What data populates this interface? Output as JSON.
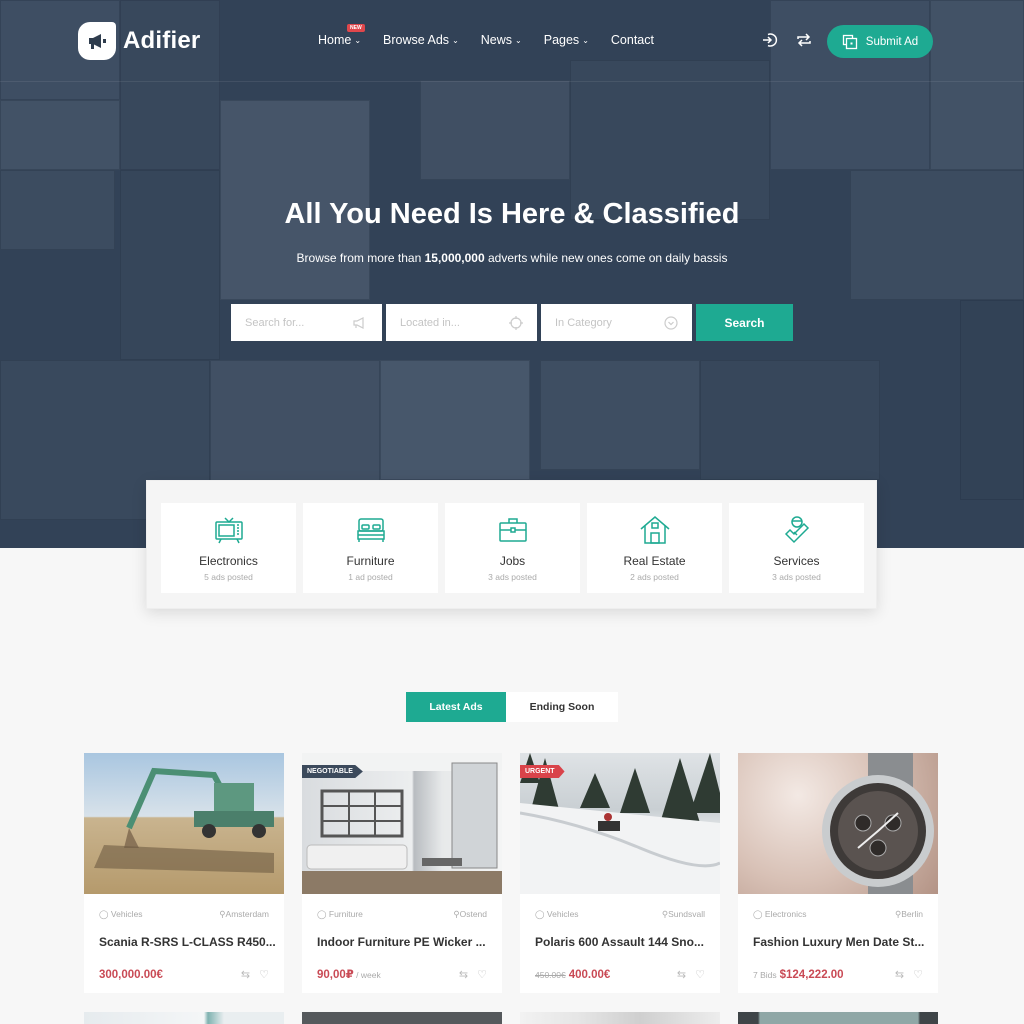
{
  "brand": {
    "name": "Adifier",
    "accent": "#1eaa92",
    "price_color": "#c94a55"
  },
  "nav": {
    "menu": [
      {
        "label": "Home",
        "has_dropdown": true,
        "badge": "NEW"
      },
      {
        "label": "Browse Ads",
        "has_dropdown": true
      },
      {
        "label": "News",
        "has_dropdown": true
      },
      {
        "label": "Pages",
        "has_dropdown": true
      },
      {
        "label": "Contact",
        "has_dropdown": false
      }
    ],
    "icons": [
      "login-icon",
      "compare-icon"
    ],
    "submit_label": "Submit Ad"
  },
  "hero": {
    "title": "All You Need Is Here & Classified",
    "subtitle_before": "Browse from more than ",
    "subtitle_bold": "15,000,000",
    "subtitle_after": " adverts while new ones come on daily bassis",
    "search": {
      "keyword_placeholder": "Search for...",
      "location_placeholder": "Located in...",
      "category_placeholder": "In Category",
      "button_label": "Search"
    }
  },
  "categories": [
    {
      "name": "Electronics",
      "count": "5 ads posted",
      "icon": "tv-icon"
    },
    {
      "name": "Furniture",
      "count": "1 ad posted",
      "icon": "bed-icon"
    },
    {
      "name": "Jobs",
      "count": "3 ads posted",
      "icon": "briefcase-icon"
    },
    {
      "name": "Real Estate",
      "count": "2 ads posted",
      "icon": "house-icon"
    },
    {
      "name": "Services",
      "count": "3 ads posted",
      "icon": "services-icon"
    }
  ],
  "tabs": [
    {
      "label": "Latest Ads",
      "active": true
    },
    {
      "label": "Ending Soon",
      "active": false
    }
  ],
  "ads": [
    {
      "ribbon": "",
      "category": "Vehicles",
      "location": "Amsterdam",
      "title": "Scania R-SRS L-CLASS R450...",
      "price_pre": "",
      "price_old": "",
      "price": "300,000.00€",
      "price_suffix": ""
    },
    {
      "ribbon": "NEGOTIABLE",
      "ribbon_color": "#3c4a5c",
      "category": "Furniture",
      "location": "Ostend",
      "title": "Indoor Furniture PE Wicker ...",
      "price_pre": "",
      "price_old": "",
      "price": "90,00₽",
      "price_suffix": " / week"
    },
    {
      "ribbon": "URGENT",
      "ribbon_color": "#d9434a",
      "category": "Vehicles",
      "location": "Sundsvall",
      "title": "Polaris 600 Assault 144 Sno...",
      "price_pre": "",
      "price_old": "450.00€",
      "price": "400.00€",
      "price_suffix": ""
    },
    {
      "ribbon": "",
      "category": "Electronics",
      "location": "Berlin",
      "title": "Fashion Luxury Men Date St...",
      "price_pre": "7 Bids",
      "price_old": "",
      "price": "$124,222.00",
      "price_suffix": ""
    }
  ]
}
